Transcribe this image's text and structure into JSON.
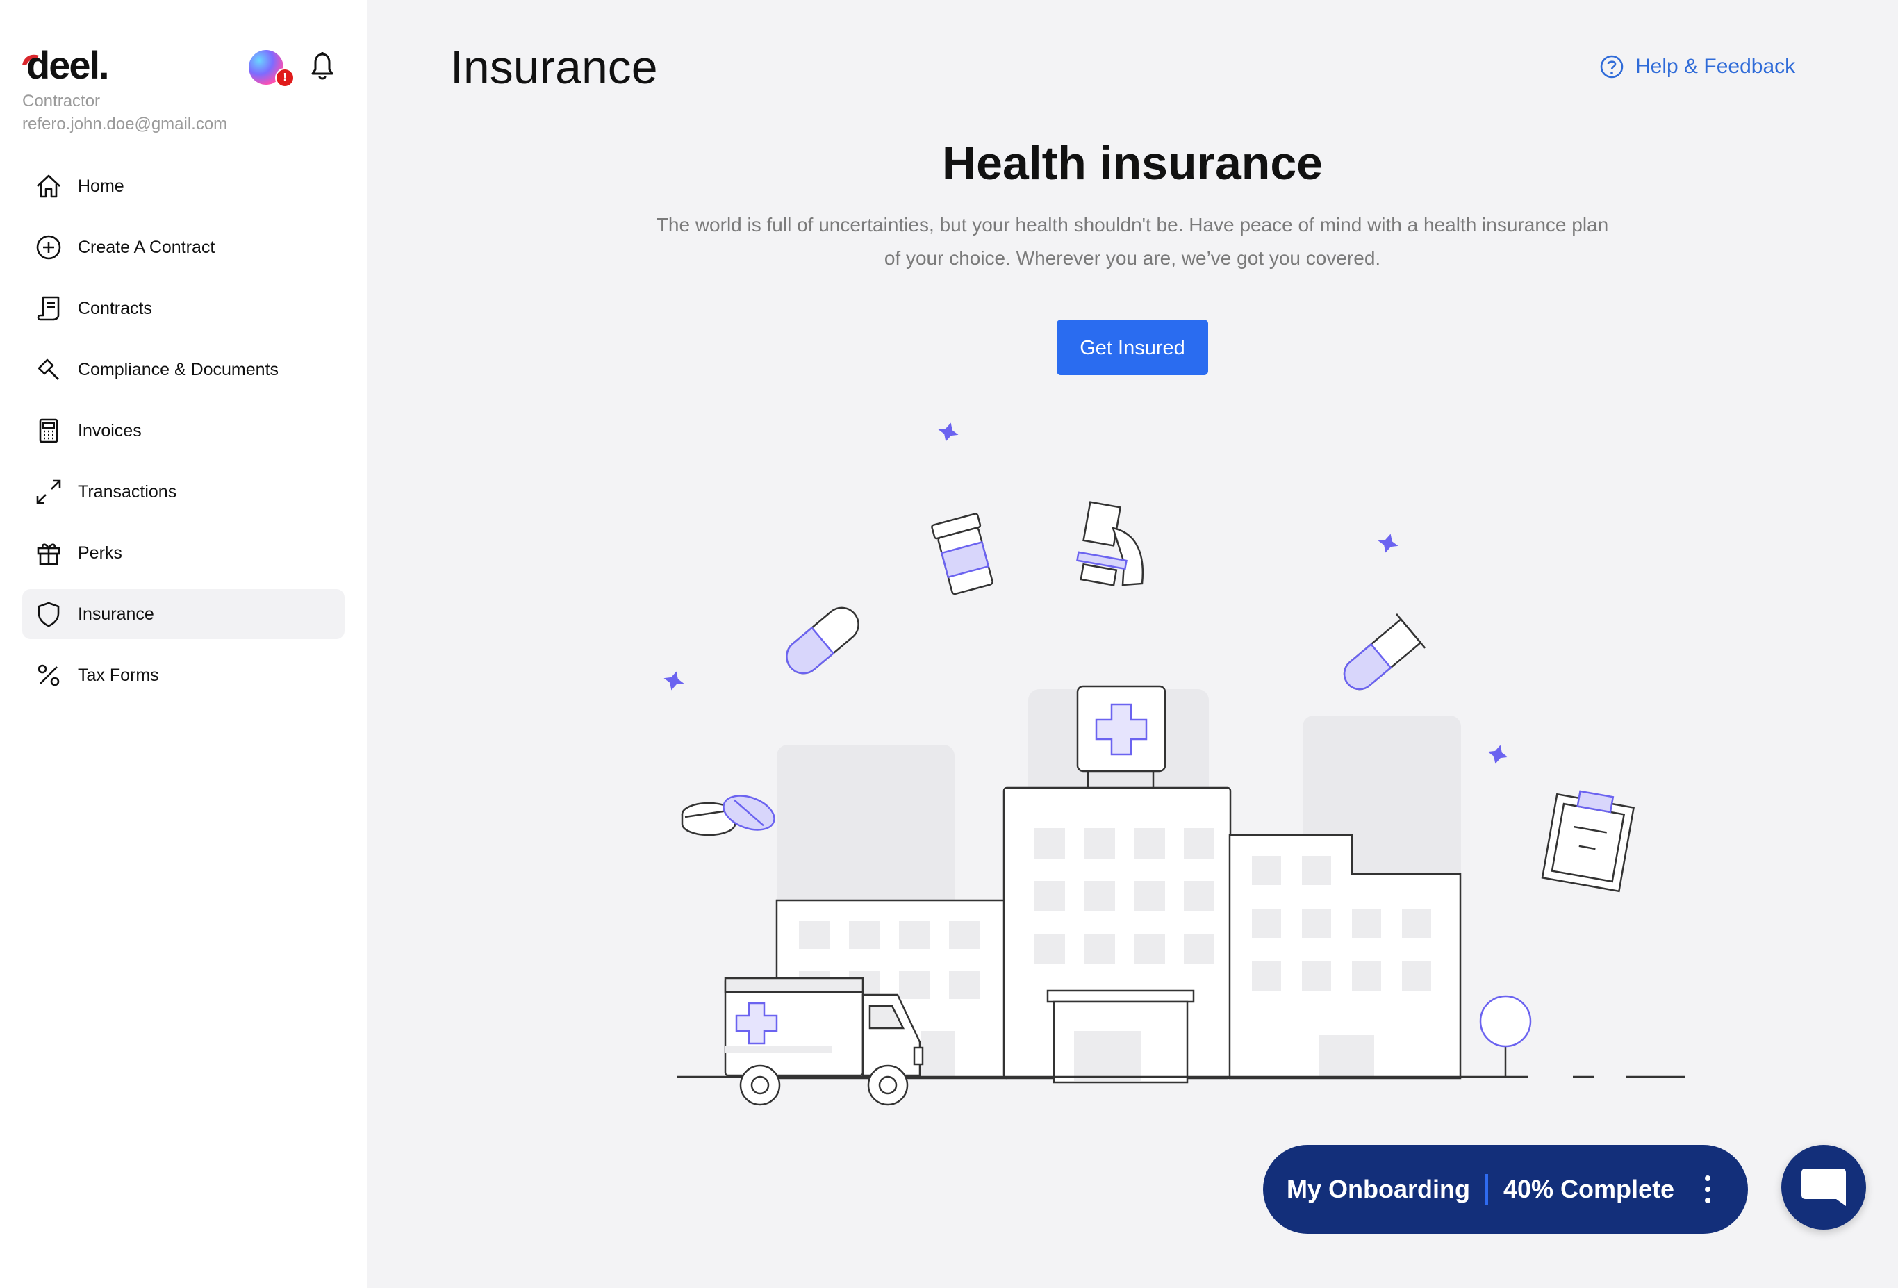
{
  "brand": {
    "logo_text": "deel."
  },
  "user": {
    "role": "Contractor",
    "email": "refero.john.doe@gmail.com",
    "badge": "!"
  },
  "sidebar": {
    "items": [
      {
        "label": "Home",
        "icon": "home-icon"
      },
      {
        "label": "Create A Contract",
        "icon": "plus-circle-icon"
      },
      {
        "label": "Contracts",
        "icon": "scroll-icon"
      },
      {
        "label": "Compliance & Documents",
        "icon": "gavel-icon"
      },
      {
        "label": "Invoices",
        "icon": "calculator-icon"
      },
      {
        "label": "Transactions",
        "icon": "arrows-diagonal-icon"
      },
      {
        "label": "Perks",
        "icon": "gift-icon"
      },
      {
        "label": "Insurance",
        "icon": "shield-icon",
        "active": true
      },
      {
        "label": "Tax Forms",
        "icon": "percent-icon"
      }
    ]
  },
  "header": {
    "title": "Insurance",
    "help_label": "Help & Feedback"
  },
  "hero": {
    "title": "Health insurance",
    "description": "The world is full of uncertainties, but your health shouldn't be. Have peace of mind with a health insurance plan of your choice. Wherever you are, we’ve got you covered.",
    "cta_label": "Get Insured"
  },
  "onboarding": {
    "label": "My Onboarding",
    "progress_text": "40% Complete",
    "progress": 0.4
  },
  "colors": {
    "accent": "#2a6cf0",
    "navy": "#132f7a",
    "illustration_purple": "#6b63f0",
    "link": "#2f6bd8"
  }
}
